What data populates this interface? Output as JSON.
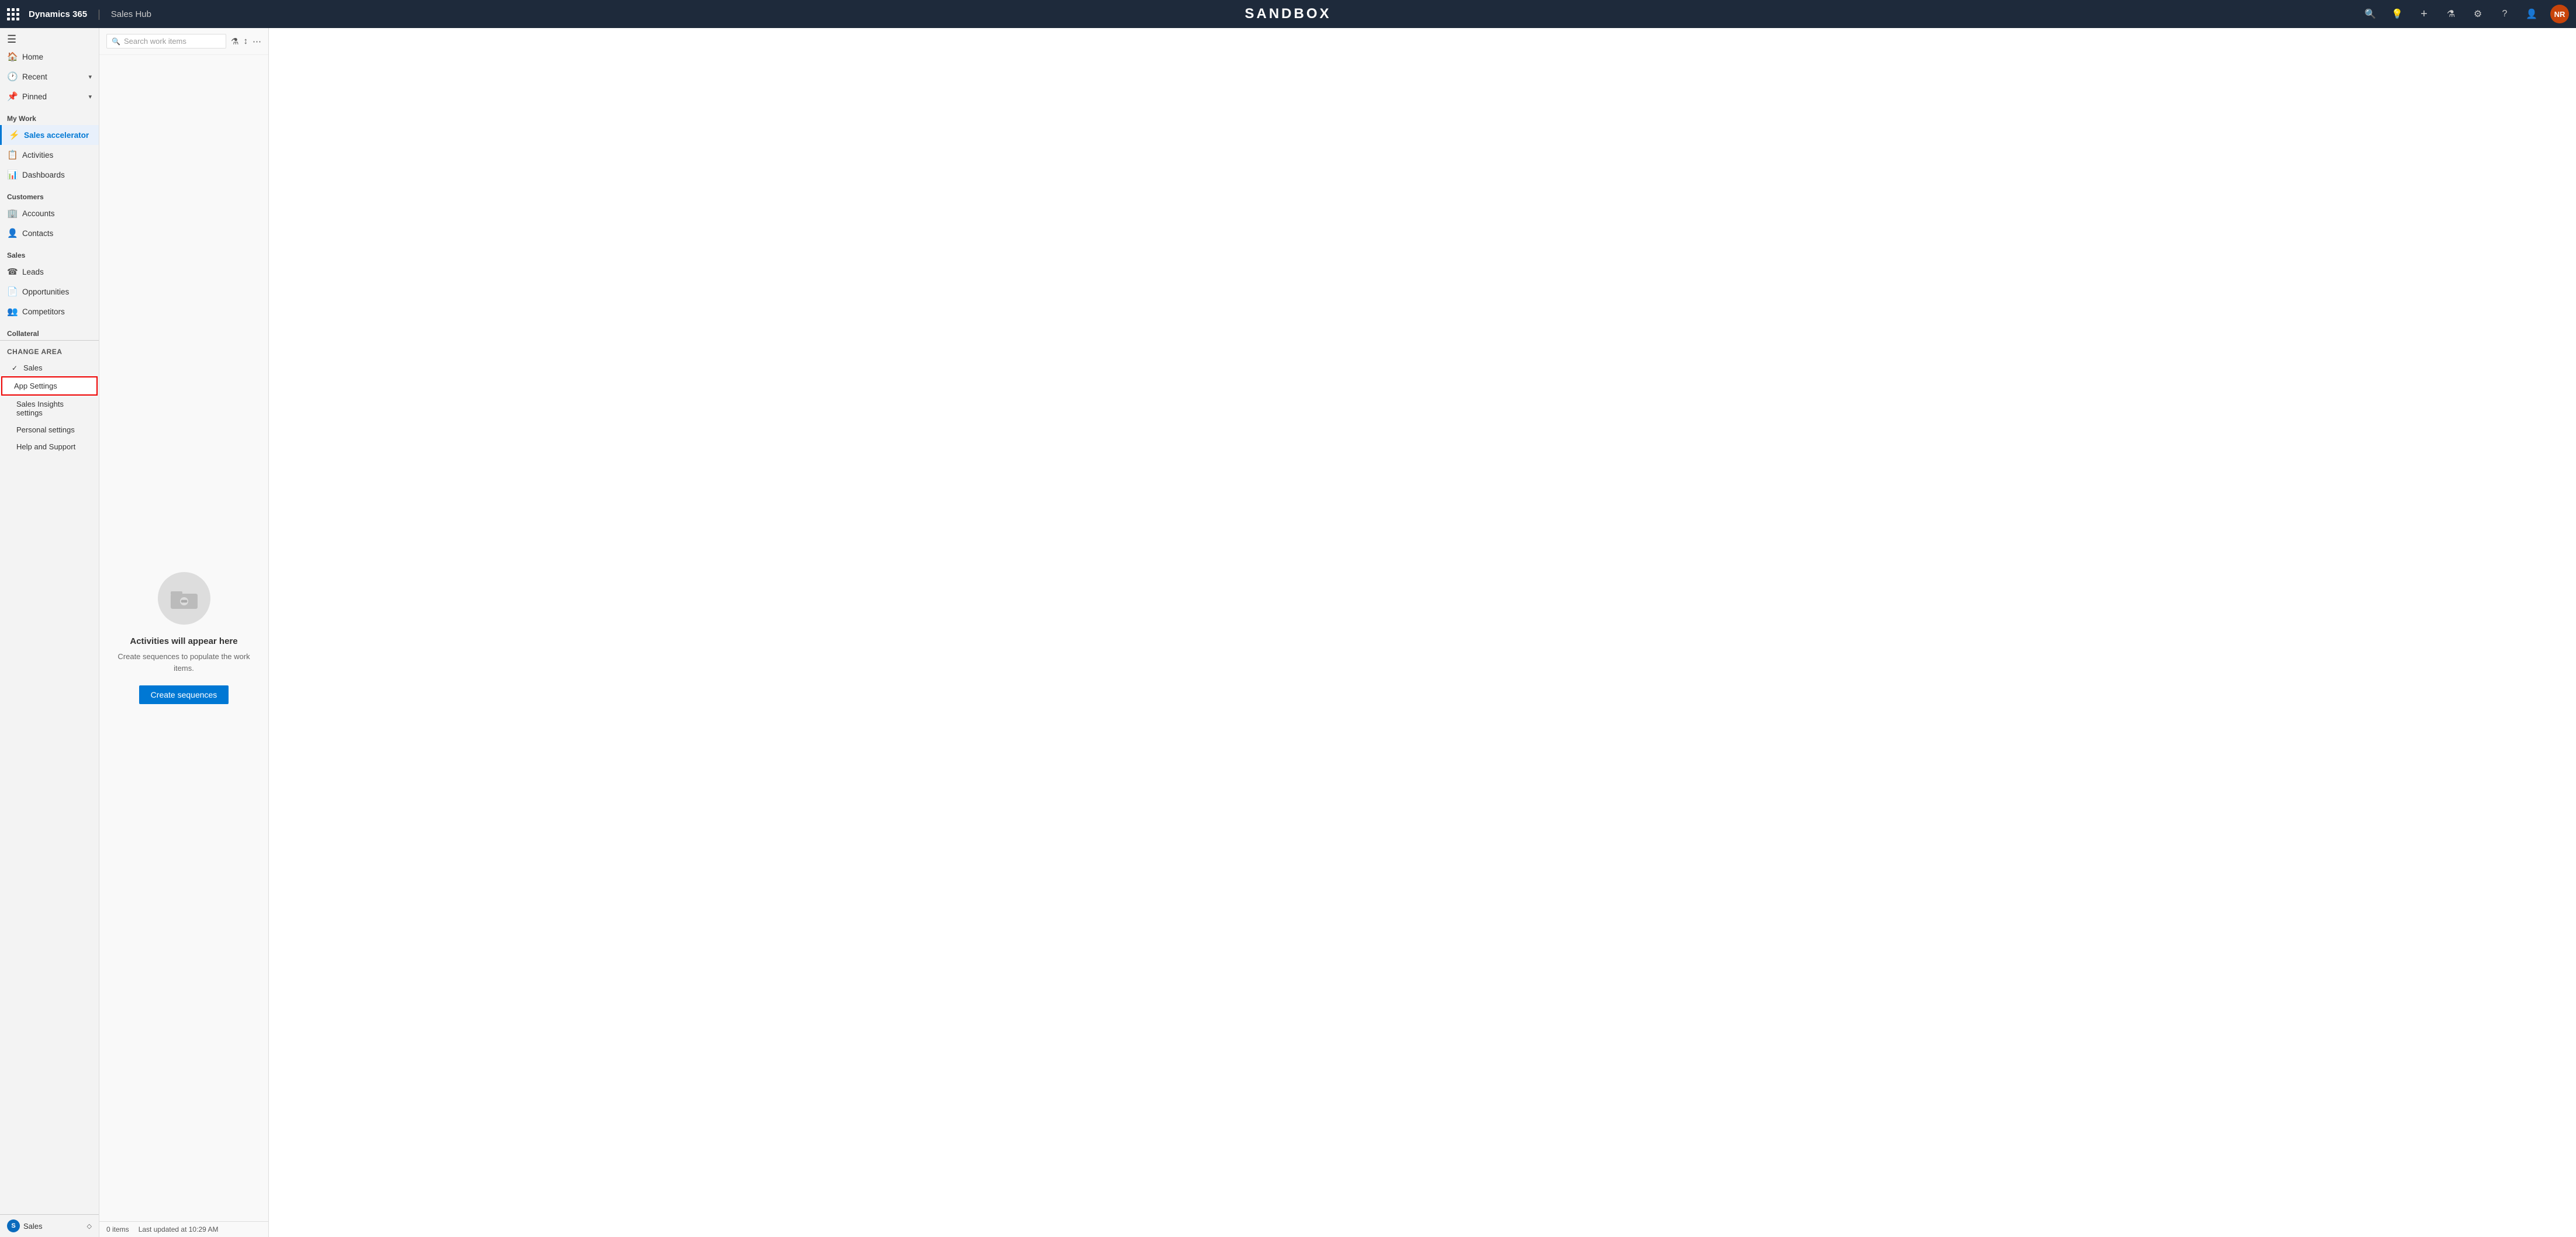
{
  "topNav": {
    "brand": "Dynamics 365",
    "divider": "|",
    "app": "Sales Hub",
    "title": "SANDBOX",
    "icons": {
      "search": "🔍",
      "lightbulb": "💡",
      "plus": "+",
      "filter": "⚗",
      "settings": "⚙",
      "question": "?",
      "person": "👤"
    },
    "avatar": "NR"
  },
  "sidebar": {
    "sections": [
      {
        "label": "",
        "items": [
          {
            "id": "home",
            "label": "Home",
            "icon": "🏠",
            "active": false
          },
          {
            "id": "recent",
            "label": "Recent",
            "icon": "🕐",
            "hasChevron": true,
            "active": false
          },
          {
            "id": "pinned",
            "label": "Pinned",
            "icon": "📌",
            "hasChevron": true,
            "active": false
          }
        ]
      },
      {
        "label": "My Work",
        "items": [
          {
            "id": "sales-accelerator",
            "label": "Sales accelerator",
            "icon": "⚡",
            "active": true
          },
          {
            "id": "activities",
            "label": "Activities",
            "icon": "📋",
            "active": false
          },
          {
            "id": "dashboards",
            "label": "Dashboards",
            "icon": "📊",
            "active": false
          }
        ]
      },
      {
        "label": "Customers",
        "items": [
          {
            "id": "accounts",
            "label": "Accounts",
            "icon": "🏢",
            "active": false
          },
          {
            "id": "contacts",
            "label": "Contacts",
            "icon": "👤",
            "active": false
          }
        ]
      },
      {
        "label": "Sales",
        "items": [
          {
            "id": "leads",
            "label": "Leads",
            "icon": "☎",
            "active": false
          },
          {
            "id": "opportunities",
            "label": "Opportunities",
            "icon": "📄",
            "active": false
          },
          {
            "id": "competitors",
            "label": "Competitors",
            "icon": "👥",
            "active": false
          }
        ]
      },
      {
        "label": "Collateral",
        "items": []
      }
    ],
    "changeArea": {
      "header": "Change area",
      "items": [
        {
          "id": "sales",
          "label": "Sales",
          "checked": true
        },
        {
          "id": "app-settings",
          "label": "App Settings",
          "highlighted": true
        }
      ]
    },
    "subItems": [
      {
        "id": "sales-insights-settings",
        "label": "Sales Insights settings"
      },
      {
        "id": "personal-settings",
        "label": "Personal settings"
      },
      {
        "id": "help-and-support",
        "label": "Help and Support"
      }
    ],
    "footer": {
      "icon": "S",
      "label": "Sales",
      "iconBg": "#0a6bbd"
    }
  },
  "workItems": {
    "searchPlaceholder": "Search work items",
    "emptyState": {
      "title": "Activities will appear here",
      "description": "Create sequences to populate the work items.",
      "buttonLabel": "Create sequences"
    },
    "statusBar": {
      "count": "0 items",
      "lastUpdated": "Last updated at 10:29 AM"
    }
  }
}
